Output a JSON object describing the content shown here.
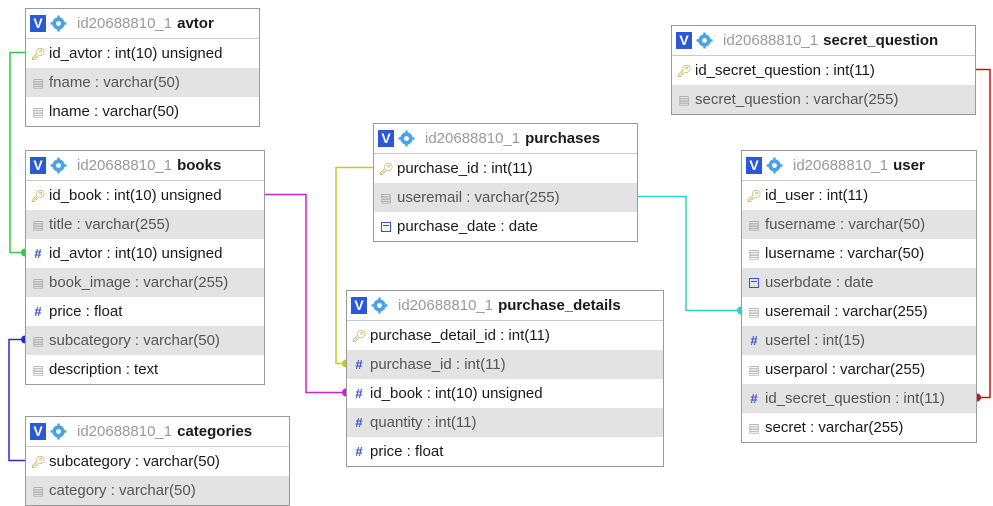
{
  "tables": [
    {
      "id": "avtor",
      "prefix": "id20688810_1",
      "name": "avtor",
      "v": "V",
      "fields": [
        {
          "text": "id_avtor : int(10) unsigned",
          "icon": "key-icon"
        },
        {
          "text": "fname : varchar(50)",
          "icon": "column-icon"
        },
        {
          "text": "lname : varchar(50)",
          "icon": "column-icon"
        }
      ]
    },
    {
      "id": "books",
      "prefix": "id20688810_1",
      "name": "books",
      "v": "V",
      "fields": [
        {
          "text": "id_book : int(10) unsigned",
          "icon": "key-icon"
        },
        {
          "text": "title : varchar(255)",
          "icon": "column-icon"
        },
        {
          "text": "id_avtor : int(10) unsigned",
          "icon": "hash-icon"
        },
        {
          "text": "book_image : varchar(255)",
          "icon": "column-icon"
        },
        {
          "text": "price : float",
          "icon": "hash-icon"
        },
        {
          "text": "subcategory : varchar(50)",
          "icon": "column-icon"
        },
        {
          "text": "description : text",
          "icon": "column-icon"
        }
      ]
    },
    {
      "id": "categories",
      "prefix": "id20688810_1",
      "name": "categories",
      "v": "V",
      "fields": [
        {
          "text": "subcategory : varchar(50)",
          "icon": "key-icon"
        },
        {
          "text": "category : varchar(50)",
          "icon": "column-icon"
        }
      ]
    },
    {
      "id": "purchases",
      "prefix": "id20688810_1",
      "name": "purchases",
      "v": "V",
      "fields": [
        {
          "text": "purchase_id : int(11)",
          "icon": "key-icon"
        },
        {
          "text": "useremail : varchar(255)",
          "icon": "column-icon"
        },
        {
          "text": "purchase_date : date",
          "icon": "date-icon"
        }
      ]
    },
    {
      "id": "purchase_details",
      "prefix": "id20688810_1",
      "name": "purchase_details",
      "v": "V",
      "fields": [
        {
          "text": "purchase_detail_id : int(11)",
          "icon": "key-icon"
        },
        {
          "text": "purchase_id : int(11)",
          "icon": "hash-icon"
        },
        {
          "text": "id_book : int(10) unsigned",
          "icon": "hash-icon"
        },
        {
          "text": "quantity : int(11)",
          "icon": "hash-icon"
        },
        {
          "text": "price : float",
          "icon": "hash-icon"
        }
      ]
    },
    {
      "id": "secret_question",
      "prefix": "id20688810_1",
      "name": "secret_question",
      "v": "V",
      "fields": [
        {
          "text": "id_secret_question : int(11)",
          "icon": "key-icon"
        },
        {
          "text": "secret_question : varchar(255)",
          "icon": "column-icon"
        }
      ]
    },
    {
      "id": "user",
      "prefix": "id20688810_1",
      "name": "user",
      "v": "V",
      "fields": [
        {
          "text": "id_user : int(11)",
          "icon": "key-icon"
        },
        {
          "text": "fusername : varchar(50)",
          "icon": "column-icon"
        },
        {
          "text": "lusername : varchar(50)",
          "icon": "column-icon"
        },
        {
          "text": "userbdate : date",
          "icon": "date-icon"
        },
        {
          "text": "useremail : varchar(255)",
          "icon": "column-icon"
        },
        {
          "text": "usertel : int(15)",
          "icon": "hash-icon"
        },
        {
          "text": "userparol : varchar(255)",
          "icon": "column-icon"
        },
        {
          "text": "id_secret_question : int(11)",
          "icon": "hash-icon"
        },
        {
          "text": "secret : varchar(255)",
          "icon": "column-icon"
        }
      ]
    }
  ],
  "relations": [
    {
      "from": "books.id_avtor",
      "to": "avtor.id_avtor",
      "color": "#2ecc40"
    },
    {
      "from": "books.subcategory",
      "to": "categories.subcategory",
      "color": "#2a2ad0"
    },
    {
      "from": "purchase_details.id_book",
      "to": "books.id_book",
      "color": "#d020d0"
    },
    {
      "from": "purchase_details.purchase_id",
      "to": "purchases.purchase_id",
      "color": "#c8c820"
    },
    {
      "from": "purchases.useremail",
      "to": "user.useremail",
      "color": "#2ecfcf"
    },
    {
      "from": "user.id_secret_question",
      "to": "secret_question.id_secret_question",
      "color": "#c81414"
    }
  ]
}
